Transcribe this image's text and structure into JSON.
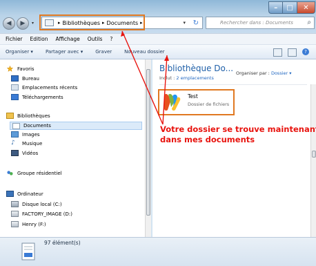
{
  "window": {
    "controls": {
      "minimize": "–",
      "maximize": "□",
      "close": "✕"
    }
  },
  "address_bar": {
    "crumbs": [
      "Bibliothèques",
      "Documents"
    ],
    "separator": "▸",
    "dropdown": "▾",
    "refresh": "↻",
    "search_placeholder": "Rechercher dans : Documents"
  },
  "menubar": {
    "items": [
      "Fichier",
      "Edition",
      "Affichage",
      "Outils",
      "?"
    ]
  },
  "toolbar": {
    "organize": "Organiser ▾",
    "share": "Partager avec ▾",
    "burn": "Graver",
    "new_folder": "Nouveau dossier"
  },
  "nav": {
    "favorites": "Favoris",
    "desktop": "Bureau",
    "recent": "Emplacements récents",
    "downloads": "Téléchargements",
    "libraries": "Bibliothèques",
    "documents": "Documents",
    "images": "Images",
    "music": "Musique",
    "videos": "Vidéos",
    "homegroup": "Groupe résidentiel",
    "computer": "Ordinateur",
    "disk_c": "Disque local (C:)",
    "disk_d": "FACTORY_IMAGE (D:)",
    "disk_f": "Henry (F:)"
  },
  "content": {
    "library_title": "Bibliothèque Do...",
    "includes_label": "Inclut :",
    "includes_link": "2 emplacements",
    "arrange_label": "Organiser par :",
    "arrange_value": "Dossier ▾",
    "item": {
      "name": "Test",
      "type": "Dossier de fichiers"
    }
  },
  "status": {
    "count": "97 élément(s)"
  },
  "annotation": {
    "line1": "Votre dossier se trouve maintenant",
    "line2": "dans mes documents",
    "color": "#e8140f"
  },
  "colors": {
    "highlight": "#e07820",
    "accent": "#1e5fa8"
  },
  "icons": {
    "favorites": "star-icon",
    "library": "library-icon",
    "computer": "computer-icon"
  }
}
